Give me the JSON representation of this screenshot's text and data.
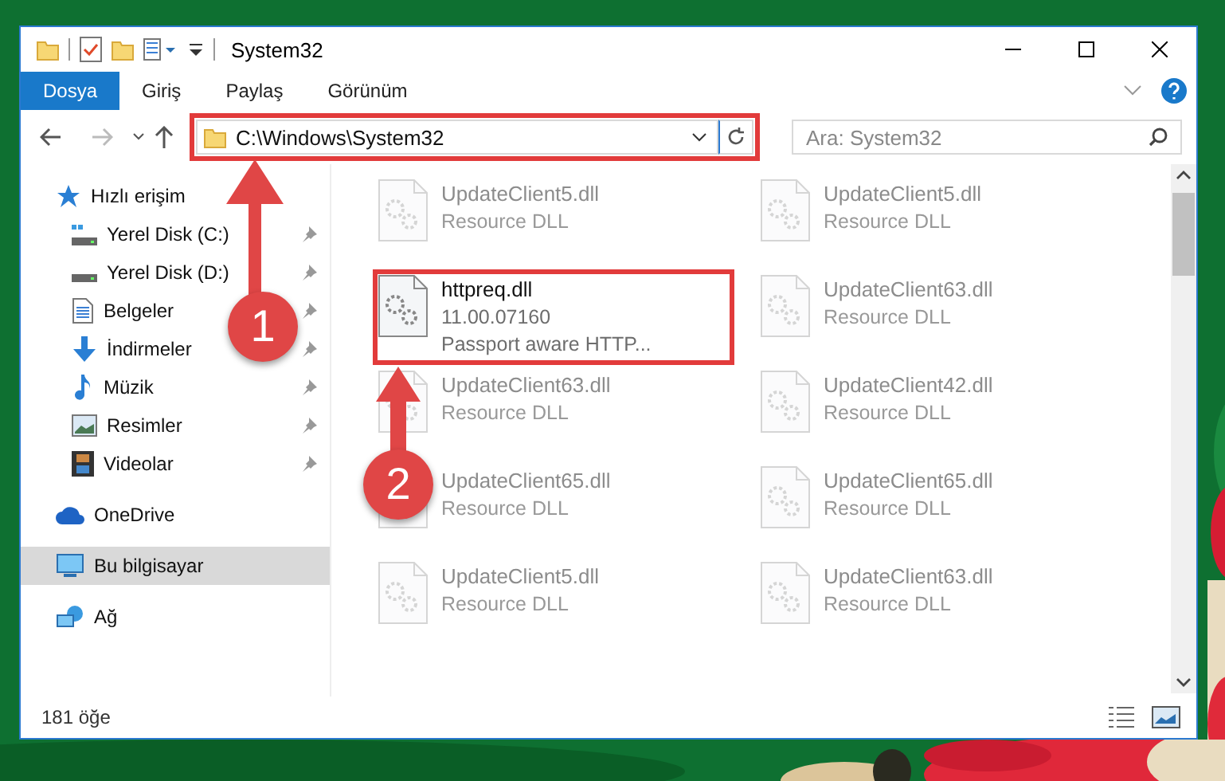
{
  "window": {
    "title": "System32"
  },
  "ribbon": {
    "tabs": [
      {
        "label": "Dosya",
        "selected": true
      },
      {
        "label": "Giriş",
        "selected": false
      },
      {
        "label": "Paylaş",
        "selected": false
      },
      {
        "label": "Görünüm",
        "selected": false
      }
    ]
  },
  "address_bar": {
    "path": "C:\\Windows\\System32",
    "highlighted": true
  },
  "search": {
    "placeholder": "Ara: System32"
  },
  "sidebar": {
    "items": [
      {
        "label": "Hızlı erişim",
        "kind": "star",
        "selected": false,
        "children": [
          {
            "label": "Yerel Disk (C:)",
            "kind": "system-drive",
            "pinned": true,
            "selected": false
          },
          {
            "label": "Yerel Disk (D:)",
            "kind": "drive",
            "pinned": true,
            "selected": false
          },
          {
            "label": "Belgeler",
            "kind": "document",
            "pinned": true,
            "selected": false
          },
          {
            "label": "İndirmeler",
            "kind": "download",
            "pinned": true,
            "selected": false
          },
          {
            "label": "Müzik",
            "kind": "music",
            "pinned": true,
            "selected": false
          },
          {
            "label": "Resimler",
            "pinned": true,
            "selected": false
          },
          {
            "label": "Videolar",
            "kind": "video",
            "pinned": true,
            "selected": false
          }
        ]
      },
      {
        "label": "OneDrive",
        "kind": "cloud",
        "selected": false
      },
      {
        "label": "Bu bilgisayar",
        "kind": "computer",
        "selected": true
      },
      {
        "label": "Ağ",
        "kind": "network",
        "selected": false
      }
    ]
  },
  "files": [
    {
      "name": "UpdateClient5.dll",
      "lines": [
        "Resource DLL"
      ],
      "dimmed": true,
      "highlighted": false
    },
    {
      "name": "UpdateClient5.dll",
      "lines": [
        "Resource DLL"
      ],
      "dimmed": true,
      "highlighted": false
    },
    {
      "name": "httpreq.dll",
      "lines": [
        "11.00.07160",
        "Passport aware HTTP..."
      ],
      "dimmed": false,
      "highlighted": true
    },
    {
      "name": "UpdateClient63.dll",
      "lines": [
        "Resource DLL"
      ],
      "dimmed": true,
      "highlighted": false
    },
    {
      "name": "UpdateClient63.dll",
      "lines": [
        "Resource DLL"
      ],
      "dimmed": true,
      "highlighted": false
    },
    {
      "name": "UpdateClient42.dll",
      "lines": [
        "Resource DLL"
      ],
      "dimmed": true,
      "highlighted": false
    },
    {
      "name": "UpdateClient65.dll",
      "lines": [
        "Resource DLL"
      ],
      "dimmed": true,
      "highlighted": false
    },
    {
      "name": "UpdateClient65.dll",
      "lines": [
        "Resource DLL"
      ],
      "dimmed": true,
      "highlighted": false
    },
    {
      "name": "UpdateClient5.dll",
      "lines": [
        "Resource DLL"
      ],
      "dimmed": true,
      "highlighted": false
    },
    {
      "name": "UpdateClient63.dll",
      "lines": [
        "Resource DLL"
      ],
      "dimmed": true,
      "highlighted": false
    }
  ],
  "status_bar": {
    "count": "181 öğe"
  },
  "callouts": [
    {
      "number": "1"
    },
    {
      "number": "2"
    }
  ]
}
